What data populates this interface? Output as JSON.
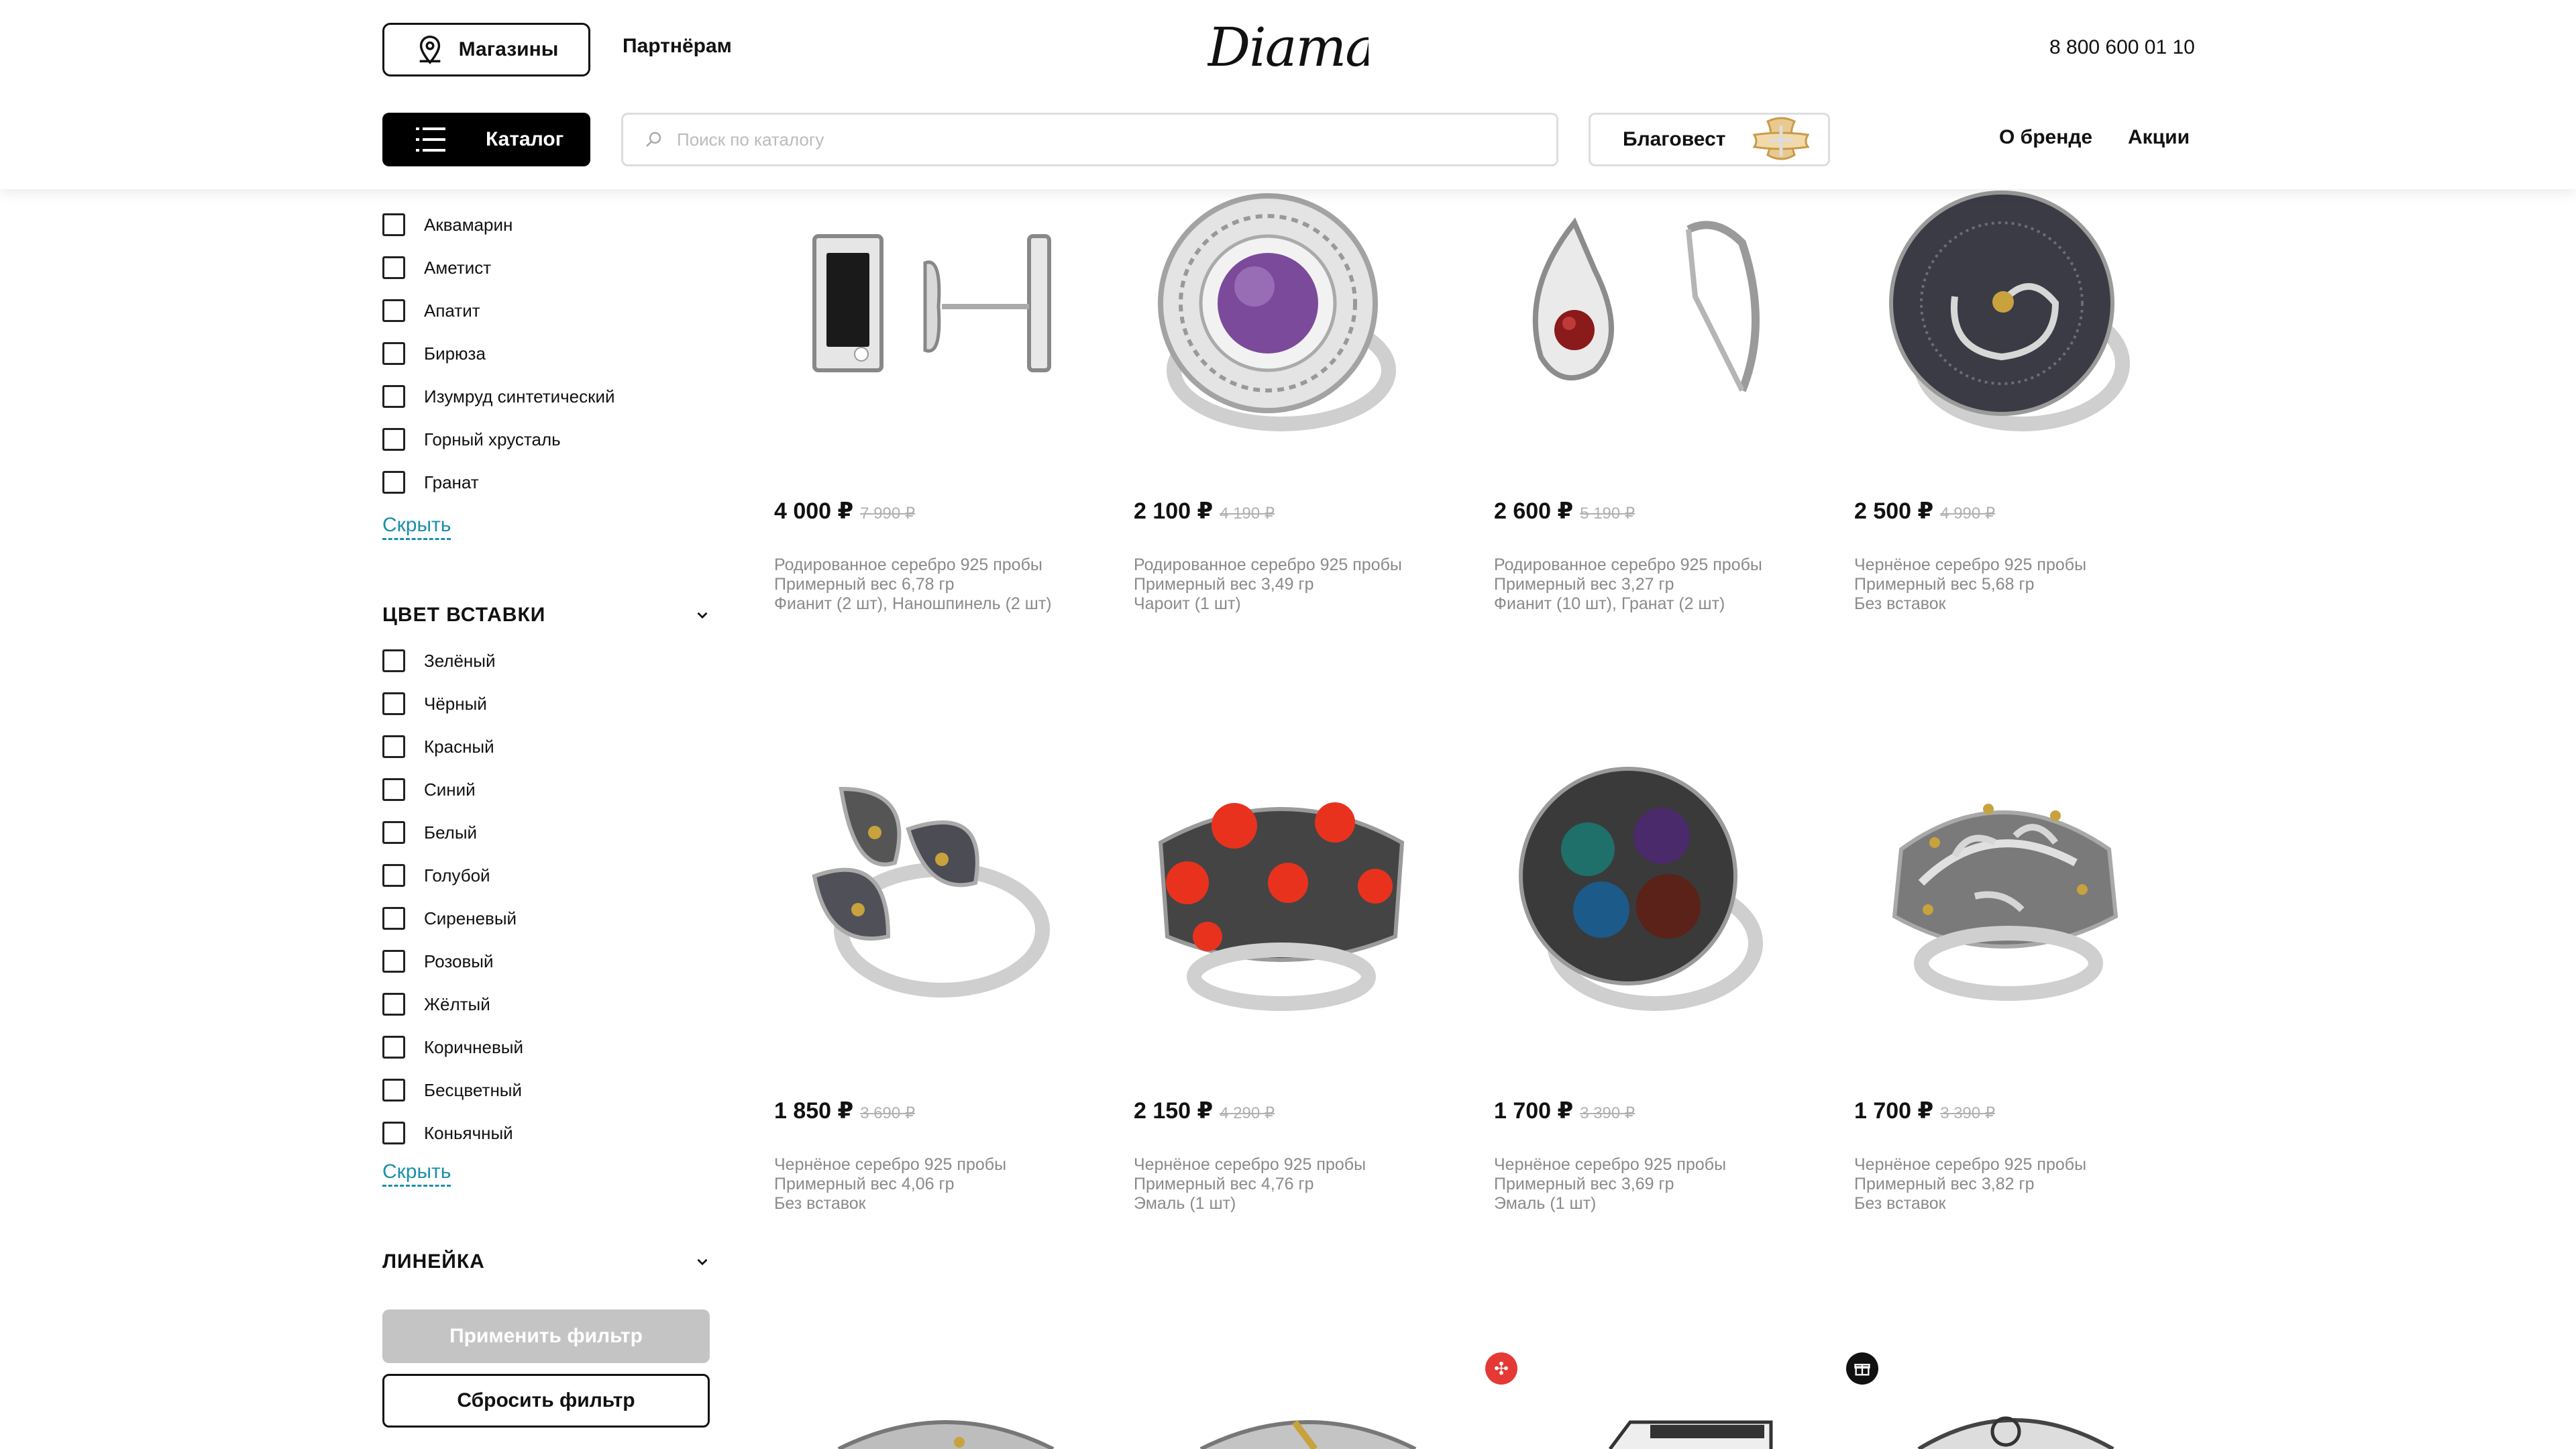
{
  "header": {
    "stores_label": "Магазины",
    "partners_label": "Партнёрам",
    "logo_text": "Diamant",
    "phone": "8 800 600 01 10",
    "catalog_label": "Каталог",
    "search_placeholder": "Поиск по каталогу",
    "blagovest_label": "Благовест",
    "about_label": "О бренде",
    "promo_label": "Акции"
  },
  "sidebar": {
    "stones": [
      "Аквамарин",
      "Аметист",
      "Апатит",
      "Бирюза",
      "Изумруд синтетический",
      "Горный хрусталь",
      "Гранат"
    ],
    "hide_label": "Скрыть",
    "color_title": "ЦВЕТ ВСТАВКИ",
    "colors": [
      "Зелёный",
      "Чёрный",
      "Красный",
      "Синий",
      "Белый",
      "Голубой",
      "Сиреневый",
      "Розовый",
      "Жёлтый",
      "Коричневый",
      "Бесцветный",
      "Коньячный"
    ],
    "line_title": "ЛИНЕЙКА",
    "apply_label": "Применить фильтр",
    "reset_label": "Сбросить фильтр"
  },
  "products": [
    {
      "price": "4 000 ₽",
      "old": "7 990 ₽",
      "d1": "Родированное серебро 925 пробы",
      "d2": "Примерный вес 6,78 гр",
      "d3": "Фианит (2 шт), Наношпинель (2 шт)",
      "icon": "cufflinks"
    },
    {
      "price": "2 100 ₽",
      "old": "4 190 ₽",
      "d1": "Родированное серебро 925 пробы",
      "d2": "Примерный вес 3,49 гр",
      "d3": "Чароит (1 шт)",
      "icon": "amethyst-ring"
    },
    {
      "price": "2 600 ₽",
      "old": "5 190 ₽",
      "d1": "Родированное серебро 925 пробы",
      "d2": "Примерный вес 3,27 гр",
      "d3": "Фианит (10 шт), Гранат (2 шт)",
      "icon": "garnet-earrings"
    },
    {
      "price": "2 500 ₽",
      "old": "4 990 ₽",
      "d1": "Чернёное серебро 925 пробы",
      "d2": "Примерный вес 5,68 гр",
      "d3": "Без вставок",
      "icon": "spiral-ring"
    },
    {
      "price": "1 850 ₽",
      "old": "3 690 ₽",
      "d1": "Чернёное серебро 925 пробы",
      "d2": "Примерный вес 4,06 гр",
      "d3": "Без вставок",
      "icon": "leaf-ring"
    },
    {
      "price": "2 150 ₽",
      "old": "4 290 ₽",
      "d1": "Чернёное серебро 925 пробы",
      "d2": "Примерный вес 4,76 гр",
      "d3": "Эмаль (1 шт)",
      "icon": "poppy-ring"
    },
    {
      "price": "1 700 ₽",
      "old": "3 390 ₽",
      "d1": "Чернёное серебро 925 пробы",
      "d2": "Примерный вес 3,69 гр",
      "d3": "Эмаль (1 шт)",
      "icon": "enamel-ring"
    },
    {
      "price": "1 700 ₽",
      "old": "3 390 ₽",
      "d1": "Чернёное серебро 925 пробы",
      "d2": "Примерный вес 3,82 гр",
      "d3": "Без вставок",
      "icon": "floral-ring"
    }
  ],
  "colors": {
    "accent": "#1b8fa8",
    "badge_red": "#e53935",
    "badge_black": "#111111",
    "apply_disabled": "#c4c4c4"
  }
}
